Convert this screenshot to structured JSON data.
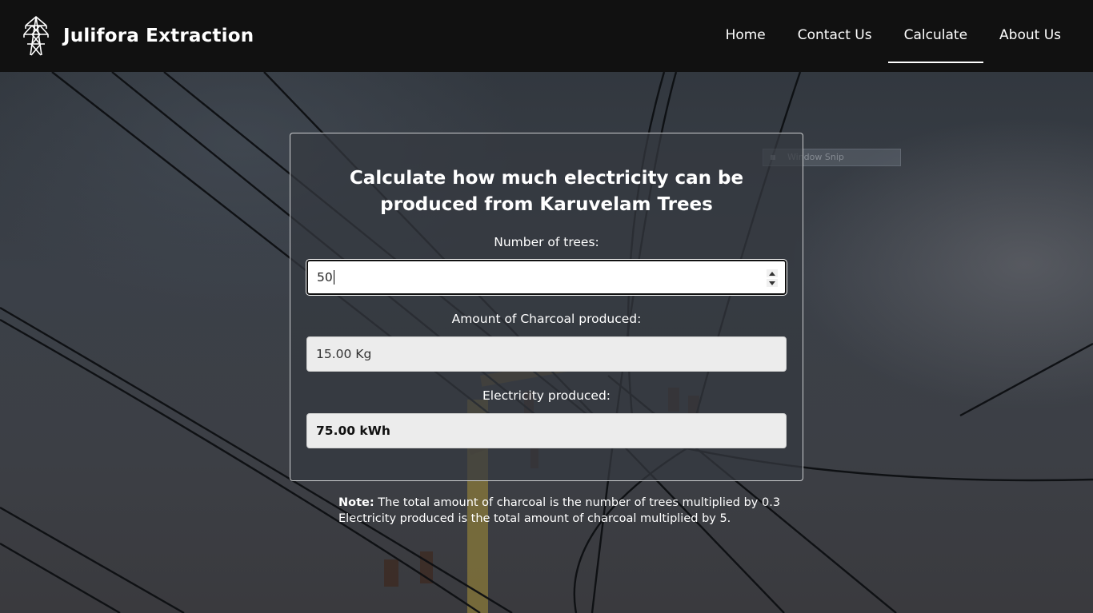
{
  "header": {
    "brand_name": "Julifora Extraction",
    "brand_icon": "power-tower-icon",
    "nav": [
      {
        "label": "Home",
        "active": false
      },
      {
        "label": "Contact Us",
        "active": false
      },
      {
        "label": "Calculate",
        "active": true
      },
      {
        "label": "About Us",
        "active": false
      }
    ]
  },
  "calculator": {
    "title": "Calculate how much electricity can be produced from Karuvelam Trees",
    "trees_label": "Number of trees:",
    "trees_value": "50",
    "charcoal_label": "Amount of Charcoal produced:",
    "charcoal_value": "15.00 Kg",
    "electricity_label": "Electricity produced:",
    "electricity_value": "75.00 kWh"
  },
  "note": {
    "prefix": "Note:",
    "line1": "The total amount of charcoal is the number of trees multiplied by 0.3",
    "line2": "Electricity produced is the total amount of charcoal multiplied by 5."
  },
  "overlay": {
    "snip_label": "Window Snip"
  },
  "colors": {
    "header_bg": "#111111",
    "text": "#ffffff",
    "readonly_field_bg": "#ececec"
  }
}
